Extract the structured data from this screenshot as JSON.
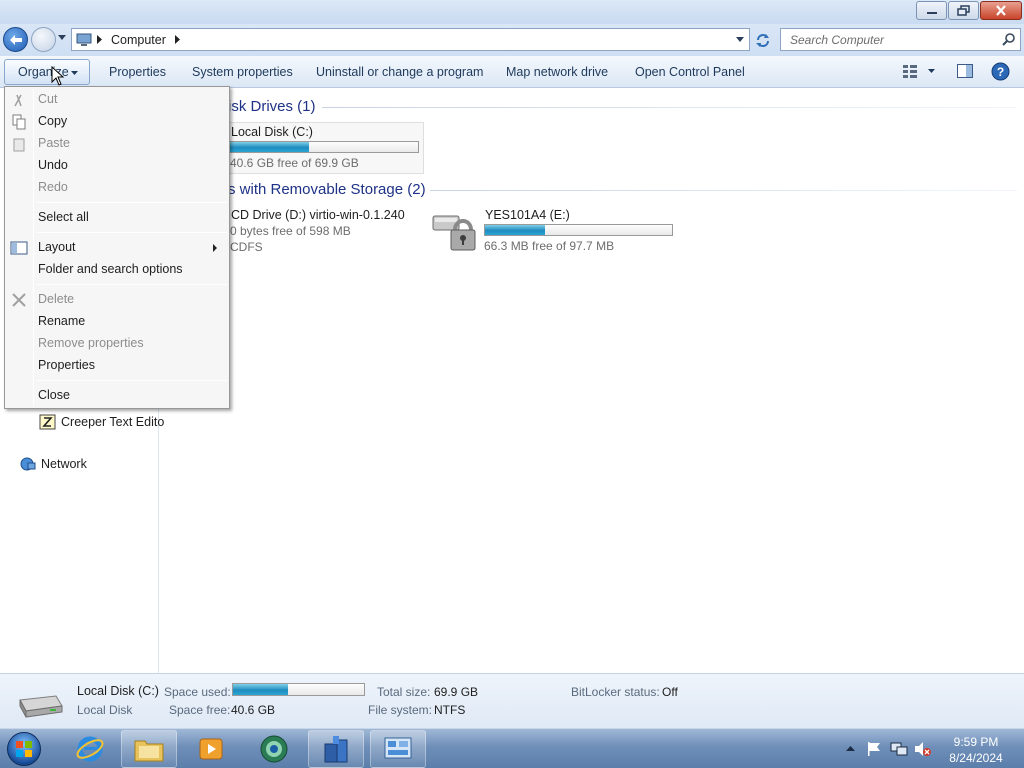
{
  "address": {
    "crumb": "Computer",
    "search_placeholder": "Search Computer"
  },
  "toolbar": {
    "organize": "Organize",
    "properties": "Properties",
    "system_properties": "System properties",
    "uninstall": "Uninstall or change a program",
    "map_drive": "Map network drive",
    "control_panel": "Open Control Panel"
  },
  "content": {
    "hdd_group": "isk Drives (1)",
    "removable_group": "s with Removable Storage (2)",
    "drives": [
      {
        "name": "Local Disk (C:)",
        "free": "40.6 GB free of 69.9 GB",
        "used_fraction": 0.42
      },
      {
        "name": "CD Drive (D:) virtio-win-0.1.240",
        "free": "0 bytes free of 598 MB",
        "fs": "CDFS"
      },
      {
        "name": "YES101A4 (E:)",
        "free": "66.3 MB free of 97.7 MB",
        "used_fraction": 0.32
      }
    ]
  },
  "nav": {
    "items": [
      {
        "label": "Creeper Text Edito"
      },
      {
        "label": "Network"
      }
    ]
  },
  "menu": {
    "items": [
      {
        "label": "Cut",
        "enabled": false
      },
      {
        "label": "Copy",
        "enabled": true
      },
      {
        "label": "Paste",
        "enabled": false
      },
      {
        "label": "Undo",
        "enabled": true
      },
      {
        "label": "Redo",
        "enabled": false
      },
      {
        "label": "Select all",
        "enabled": true
      },
      {
        "label": "Layout",
        "enabled": true
      },
      {
        "label": "Folder and search options",
        "enabled": true
      },
      {
        "label": "Delete",
        "enabled": false
      },
      {
        "label": "Rename",
        "enabled": true
      },
      {
        "label": "Remove properties",
        "enabled": false
      },
      {
        "label": "Properties",
        "enabled": true
      },
      {
        "label": "Close",
        "enabled": true
      }
    ]
  },
  "details": {
    "name": "Local Disk (C:)",
    "type": "Local Disk",
    "space_used_label": "Space used:",
    "space_used_fraction": 0.42,
    "space_free_label": "Space free:",
    "space_free": "40.6 GB",
    "total_size_label": "Total size:",
    "total_size": "69.9 GB",
    "file_system_label": "File system:",
    "file_system": "NTFS",
    "bitlocker_label": "BitLocker status:",
    "bitlocker": "Off"
  },
  "taskbar": {
    "time": "9:59 PM",
    "date": "8/24/2024"
  },
  "colors": {
    "group_header": "#1e3287",
    "bar_fill": "#2aa5d3",
    "taskbar": "#6f8fb9"
  }
}
